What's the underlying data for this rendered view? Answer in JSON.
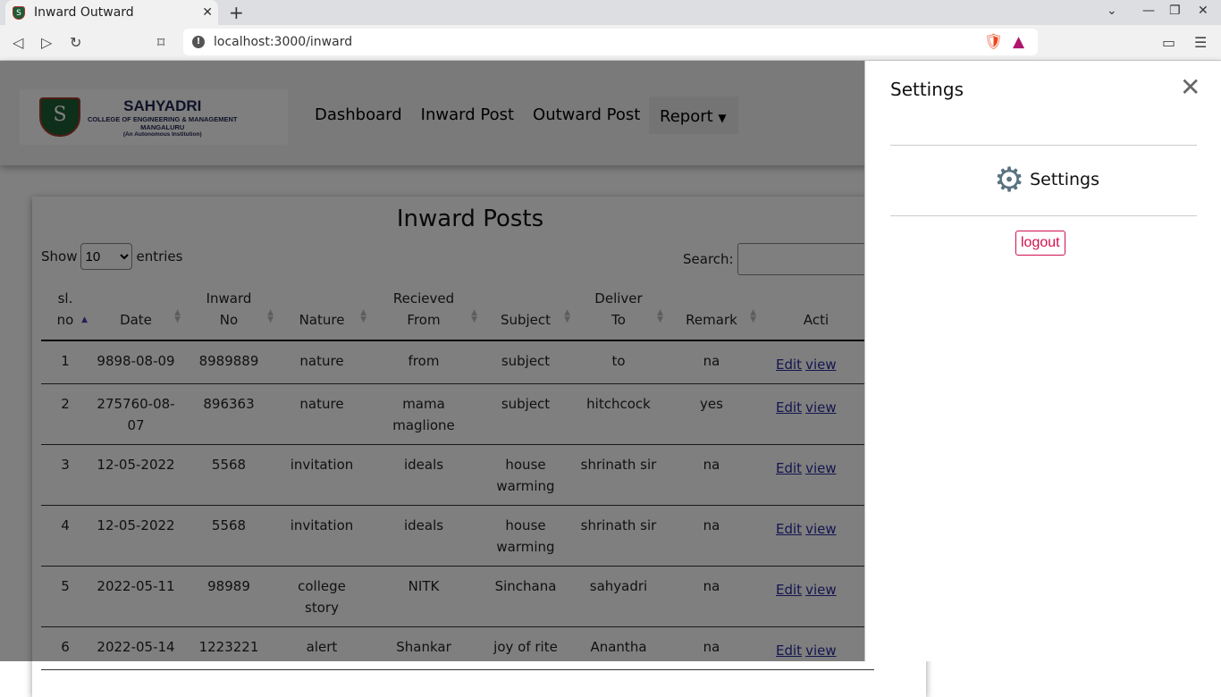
{
  "browser": {
    "tab_title": "Inward Outward",
    "url": "localhost:3000/inward"
  },
  "navbar": {
    "logo": {
      "name": "SAHYADRI",
      "line1": "COLLEGE OF ENGINEERING & MANAGEMENT",
      "line2": "MANGALURU",
      "line3": "(An Autonomous Institution)"
    },
    "links": [
      "Dashboard",
      "Inward Post",
      "Outward Post"
    ],
    "report": "Report"
  },
  "card": {
    "title": "Inward Posts",
    "show": "Show",
    "entries": "entries",
    "page_size": "10",
    "search_label": "Search:"
  },
  "table": {
    "headers": [
      [
        "sl.",
        "no"
      ],
      [
        "",
        "Date"
      ],
      [
        "Inward",
        "No"
      ],
      [
        "",
        "Nature"
      ],
      [
        "Recieved",
        "From"
      ],
      [
        "",
        "Subject"
      ],
      [
        "Deliver",
        "To"
      ],
      [
        "",
        "Remark"
      ],
      [
        "",
        "Acti"
      ]
    ],
    "rows": [
      {
        "sl": "1",
        "date": "9898-08-09",
        "no": "8989889",
        "nature": "nature",
        "from": "from",
        "subject": "subject",
        "to": "to",
        "remark": "na"
      },
      {
        "sl": "2",
        "date": "275760-08-07",
        "no": "896363",
        "nature": "nature",
        "from": "mama maglione",
        "subject": "subject",
        "to": "hitchcock",
        "remark": "yes"
      },
      {
        "sl": "3",
        "date": "12-05-2022",
        "no": "5568",
        "nature": "invitation",
        "from": "ideals",
        "subject": "house warming",
        "to": "shrinath sir",
        "remark": "na"
      },
      {
        "sl": "4",
        "date": "12-05-2022",
        "no": "5568",
        "nature": "invitation",
        "from": "ideals",
        "subject": "house warming",
        "to": "shrinath sir",
        "remark": "na"
      },
      {
        "sl": "5",
        "date": "2022-05-11",
        "no": "98989",
        "nature": "college story",
        "from": "NITK",
        "subject": "Sinchana",
        "to": "sahyadri",
        "remark": "na"
      },
      {
        "sl": "6",
        "date": "2022-05-14",
        "no": "1223221",
        "nature": "alert",
        "from": "Shankar",
        "subject": "joy of rite",
        "to": "Anantha",
        "remark": "na"
      }
    ],
    "edit": "Edit",
    "view": "view"
  },
  "panel": {
    "title": "Settings",
    "settings_label": "Settings",
    "logout": "logout"
  }
}
